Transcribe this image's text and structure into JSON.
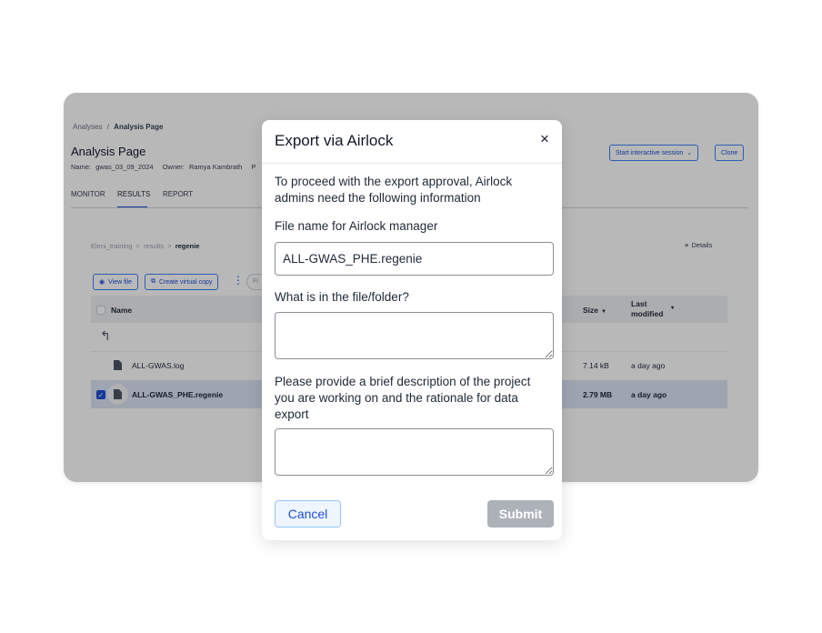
{
  "breadcrumb": {
    "parent": "Analyses",
    "separator": "/",
    "current": "Analysis Page"
  },
  "page": {
    "title": "Analysis Page",
    "name_label": "Name:",
    "name_value": "gwas_03_09_2024",
    "owner_label": "Owner:",
    "owner_value": "Ramya Kambrath",
    "truncated": "P"
  },
  "header_actions": {
    "start_session": "Start interactive session",
    "clone": "Clone"
  },
  "tabs": [
    {
      "label": "MONITOR",
      "active": false
    },
    {
      "label": "RESULTS",
      "active": true
    },
    {
      "label": "REPORT",
      "active": false
    }
  ],
  "file_path": {
    "root": "Eleni_training",
    "sep": ">",
    "mid": "results",
    "current": "regenie"
  },
  "details_label": "Details",
  "toolbar": {
    "view_file": "View file",
    "create_virtual_copy": "Create virtual copy",
    "filter_placeholder": "Fi"
  },
  "table": {
    "headers": {
      "name": "Name",
      "size": "Size",
      "last_modified_line1": "Last",
      "last_modified_line2": "modified"
    },
    "up_icon": "↰",
    "rows": [
      {
        "name": "ALL-GWAS.log",
        "size": "7.14 kB",
        "modified": "a day ago",
        "selected": false
      },
      {
        "name": "ALL-GWAS_PHE.regenie",
        "size": "2.79 MB",
        "modified": "a day ago",
        "selected": true
      }
    ]
  },
  "modal": {
    "title": "Export via Airlock",
    "close_icon": "×",
    "intro": "To proceed with the export approval, Airlock admins need the following information",
    "file_name_label": "File name for Airlock manager",
    "file_name_value": "ALL-GWAS_PHE.regenie",
    "contents_label": "What is in the file/folder?",
    "contents_value": "",
    "description_label": "Please provide a brief description of the project you are working on and the rationale for data export",
    "description_value": "",
    "cancel_label": "Cancel",
    "submit_label": "Submit"
  },
  "colors": {
    "accent": "#1d4ed8",
    "selected_row": "#dbe4f4",
    "submit_disabled": "#adb2b8",
    "overlay": "rgba(0,0,0,0.28)"
  }
}
